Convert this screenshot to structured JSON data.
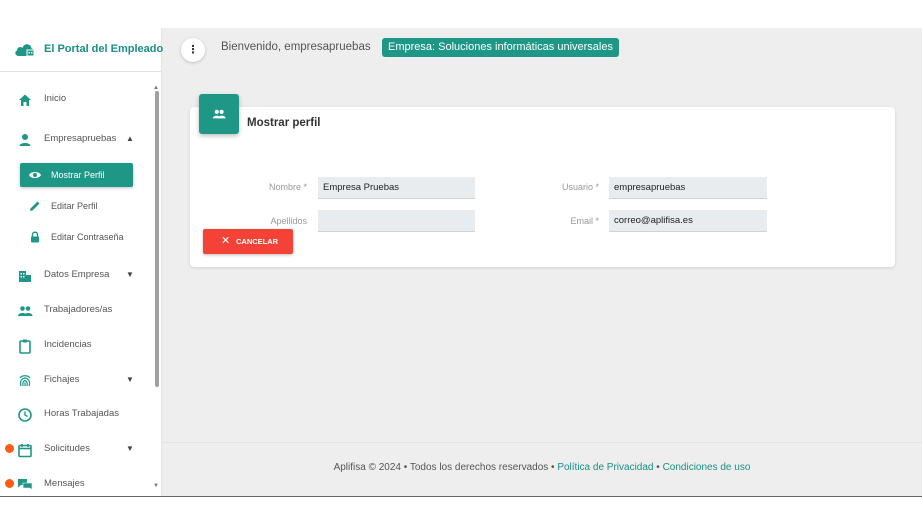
{
  "brand": {
    "name": "El Portal del Empleado"
  },
  "header": {
    "menu_icon": "⋮",
    "welcome": "Bienvenido, empresapruebas",
    "company_badge": "Empresa: Soluciones informáticas universales"
  },
  "sidebar": {
    "items": [
      {
        "label": "Inicio",
        "icon": "home-icon"
      },
      {
        "label": "Empresapruebas",
        "icon": "person-icon",
        "caret": "▲"
      },
      {
        "label": "Mostrar Perfil",
        "icon": "eye-icon",
        "active": true
      },
      {
        "label": "Editar Perfil",
        "icon": "pencil-icon"
      },
      {
        "label": "Editar Contraseña",
        "icon": "lock-icon"
      },
      {
        "label": "Datos Empresa",
        "icon": "building-icon",
        "caret": "▼"
      },
      {
        "label": "Trabajadores/as",
        "icon": "people-icon"
      },
      {
        "label": "Incidencias",
        "icon": "clipboard-icon"
      },
      {
        "label": "Fichajes",
        "icon": "fingerprint-icon",
        "caret": "▼"
      },
      {
        "label": "Horas Trabajadas",
        "icon": "clock-icon"
      },
      {
        "label": "Solicitudes",
        "icon": "calendar-icon",
        "caret": "▼"
      },
      {
        "label": "Mensajes",
        "icon": "chat-icon"
      }
    ]
  },
  "card": {
    "title": "Mostrar perfil",
    "fields": {
      "nombre": {
        "label": "Nombre *",
        "value": "Empresa Pruebas"
      },
      "apellidos": {
        "label": "Apellidos",
        "value": ""
      },
      "usuario": {
        "label": "Usuario *",
        "value": "empresapruebas"
      },
      "email": {
        "label": "Email *",
        "value": "correo@aplifisa.es"
      }
    },
    "cancel_label": "CANCELAR",
    "cancel_icon": "✕"
  },
  "footer": {
    "text": "Aplifisa © 2024 • Todos los derechos reservados • ",
    "privacy": "Política de Privacidad",
    "separator": " • ",
    "terms": "Condiciones de uso"
  },
  "colors": {
    "accent": "#1f9787",
    "danger": "#f44336",
    "notification": "#ff5b14",
    "background": "#eeeeee"
  }
}
